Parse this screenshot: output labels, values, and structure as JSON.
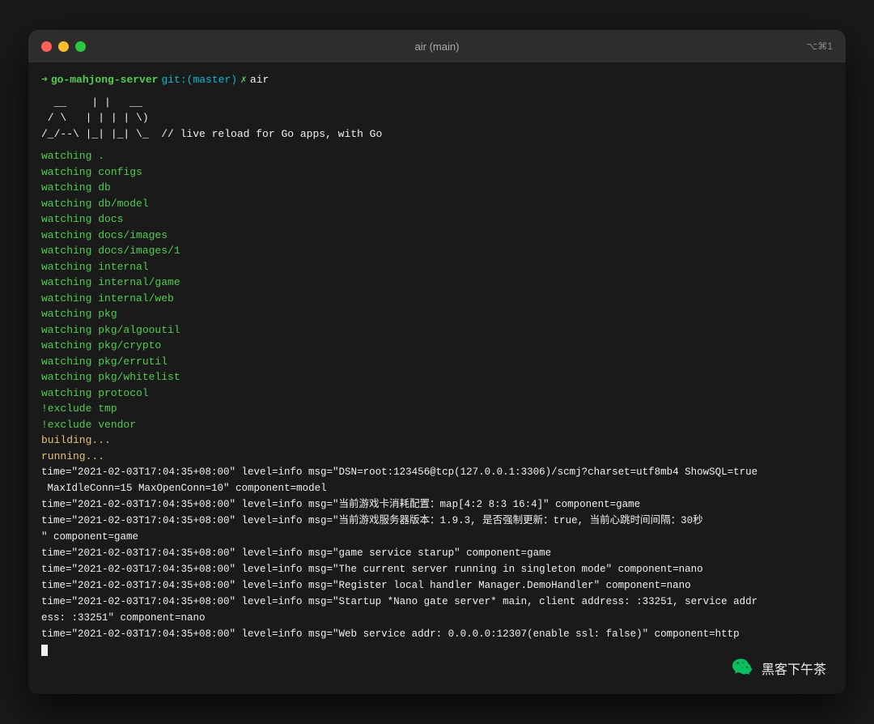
{
  "window": {
    "title": "air (main)",
    "shortcut": "⌥⌘1"
  },
  "terminal": {
    "prompt": {
      "directory": "go-mahjong-server",
      "branch": "git:(master)",
      "command": "air"
    },
    "ascii_art": "  __    | |   __\n / \\   | | | | \\)\n/_/--\\ |_| |_| \\_  // live reload for Go apps, with Go",
    "watching_lines": [
      "watching .",
      "watching configs",
      "watching db",
      "watching db/model",
      "watching docs",
      "watching docs/images",
      "watching docs/images/1",
      "watching internal",
      "watching internal/game",
      "watching internal/web",
      "watching pkg",
      "watching pkg/algooutil",
      "watching pkg/crypto",
      "watching pkg/errutil",
      "watching pkg/whitelist",
      "watching protocol",
      "!exclude tmp",
      "!exclude vendor",
      "building...",
      "running..."
    ],
    "log_lines": [
      "time=\"2021-02-03T17:04:35+08:00\" level=info msg=\"DSN=root:123456@tcp(127.0.0.1:3306)/scmj?charset=utf8mb4 ShowSQL=true MaxIdleConn=15 MaxOpenConn=10\" component=model",
      "time=\"2021-02-03T17:04:35+08:00\" level=info msg=\"当前游戏卡消耗配置：map[4:2 8:3 16:4]\" component=game",
      "time=\"2021-02-03T17:04:35+08:00\" level=info msg=\"当前游戏服务器版本：1.9.3, 是否强制更新：true, 当前心跳时间间隔：30秒\" component=game",
      "time=\"2021-02-03T17:04:35+08:00\" level=info msg=\"game service starup\" component=game",
      "time=\"2021-02-03T17:04:35+08:00\" level=info msg=\"The current server running in singleton mode\" component=nano",
      "time=\"2021-02-03T17:04:35+08:00\" level=info msg=\"Register local handler Manager.DemoHandler\" component=nano",
      "time=\"2021-02-03T17:04:35+08:00\" level=info msg=\"Startup *Nano gate server* main, client address: :33251, service address: :33251\" component=nano",
      "time=\"2021-02-03T17:04:35+08:00\" level=info msg=\"Web service addr: 0.0.0.0:12307(enable ssl: false)\" component=http"
    ]
  },
  "watermark": {
    "icon": "wechat",
    "text": "黑客下午茶"
  }
}
